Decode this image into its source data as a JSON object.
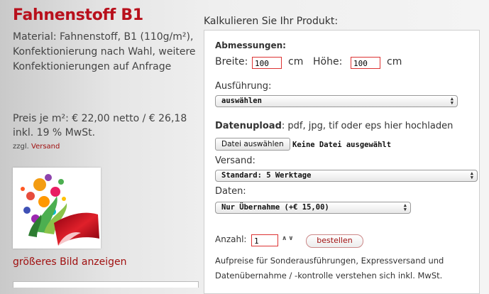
{
  "product": {
    "title": "Fahnenstoff B1",
    "material": "Material: Fahnenstoff, B1 (110g/m²), Konfektionierung nach Wahl, weitere Konfektionierungen auf Anfrage",
    "price": "Preis je m²: € 22,00 netto / € 26,18 inkl. 19 % MwSt.",
    "shipping_prefix": "zzgl.",
    "shipping_link": "Versand",
    "bigger_image": "größeres Bild anzeigen"
  },
  "calculator": {
    "heading": "Kalkulieren Sie Ihr Produkt:",
    "dimensions_label": "Abmessungen:",
    "width_label": "Breite:",
    "width_value": "100",
    "height_label": "Höhe:",
    "height_value": "100",
    "unit": "cm",
    "execution_label": "Ausführung:",
    "execution_value": "auswählen",
    "upload_label": "Datenupload",
    "upload_hint": ": pdf, jpg, tif oder eps hier hochladen",
    "file_button": "Datei auswählen",
    "no_file": "Keine Datei ausgewählt",
    "shipping_label": "Versand:",
    "shipping_value": "Standard: 5 Werktage",
    "data_label": "Daten:",
    "data_value": "Nur Übernahme (+€ 15,00)",
    "quantity_label": "Anzahl:",
    "quantity_value": "1",
    "order_button": "bestellen",
    "note": "Aufpreise für Sonderausführungen, Expressversand und Datenübernahme / -kontrolle verstehen sich inkl. MwSt."
  },
  "colors": {
    "accent": "#b8101c",
    "link": "#a01010"
  }
}
